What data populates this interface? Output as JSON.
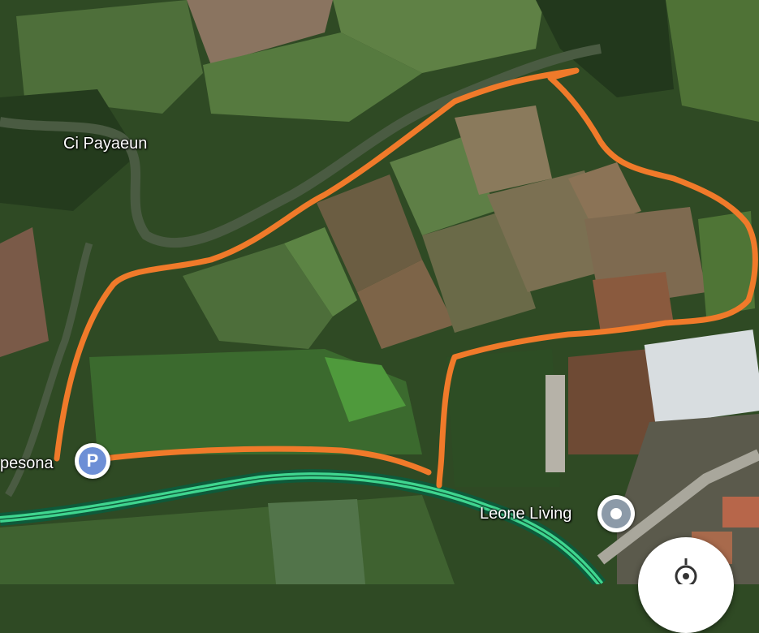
{
  "labels": {
    "river": "Ci Payaeun",
    "parking": "pesona",
    "place": "Leone Living"
  },
  "icons": {
    "parking": "parking-icon",
    "place": "location-pin-icon",
    "locate": "my-location-icon"
  },
  "parking_symbol": "P",
  "colors": {
    "boundary": "#f07a2a",
    "road_casing": "#0e5a3a",
    "road_fill": "#3fd58f",
    "parking_pin": "#6d8fd6",
    "place_pin": "#8c9aa8"
  }
}
